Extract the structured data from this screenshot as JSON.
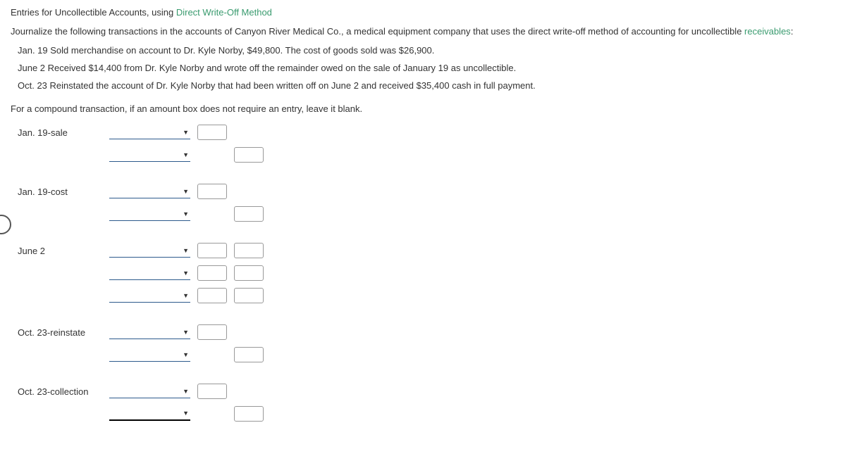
{
  "header": {
    "prefix": "Entries for Uncollectible Accounts, using ",
    "method_link": "Direct Write-Off Method"
  },
  "instruction": {
    "prefix": "Journalize the following transactions in the accounts of Canyon River Medical Co., a medical equipment company that uses the direct write-off method of accounting for uncollectible ",
    "receivables_link": "receivables",
    "suffix": ":"
  },
  "transactions": {
    "t1": "Jan. 19 Sold merchandise on account to Dr. Kyle Norby, $49,800. The cost of goods sold was $26,900.",
    "t2": "June 2 Received $14,400 from Dr. Kyle Norby and wrote off the remainder owed on the sale of January 19 as uncollectible.",
    "t3": "Oct. 23 Reinstated the account of Dr. Kyle Norby that had been written off on June 2 and received $35,400 cash in full payment."
  },
  "compound_note": "For a compound transaction, if an amount box does not require an entry, leave it blank.",
  "journal_labels": {
    "jan19_sale": "Jan. 19-sale",
    "jan19_cost": "Jan. 19-cost",
    "june2": "June 2",
    "oct23_reinstate": "Oct. 23-reinstate",
    "oct23_collection": "Oct. 23-collection"
  }
}
